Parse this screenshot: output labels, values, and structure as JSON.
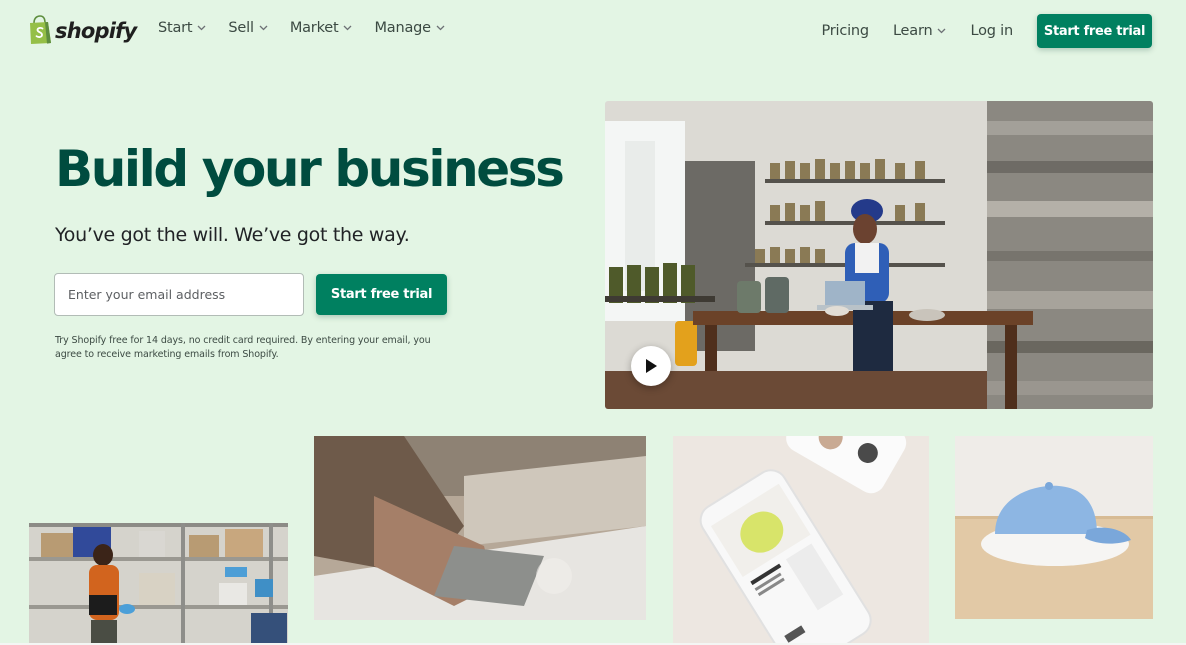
{
  "brand": {
    "name": "shopify",
    "logo_icon": "shopping-bag-icon",
    "logo_color": "#95bf47"
  },
  "nav": {
    "left": [
      {
        "label": "Start",
        "icon": "chevron-down-icon"
      },
      {
        "label": "Sell",
        "icon": "chevron-down-icon"
      },
      {
        "label": "Market",
        "icon": "chevron-down-icon"
      },
      {
        "label": "Manage",
        "icon": "chevron-down-icon"
      }
    ],
    "right": {
      "pricing": "Pricing",
      "learn": "Learn",
      "login": "Log in",
      "cta": "Start free trial"
    }
  },
  "hero": {
    "title": "Build your business",
    "subtitle": "You’ve got the will. We’ve got the way.",
    "email_placeholder": "Enter your email address",
    "cta": "Start free trial",
    "disclaimer": "Try Shopify free for 14 days, no credit card required. By entering your email, you agree to receive marketing emails from Shopify."
  },
  "media": {
    "main_video": {
      "play_icon": "play-icon"
    }
  },
  "colors": {
    "background": "#e3f5e4",
    "accent": "#008060",
    "title": "#004c3f"
  }
}
